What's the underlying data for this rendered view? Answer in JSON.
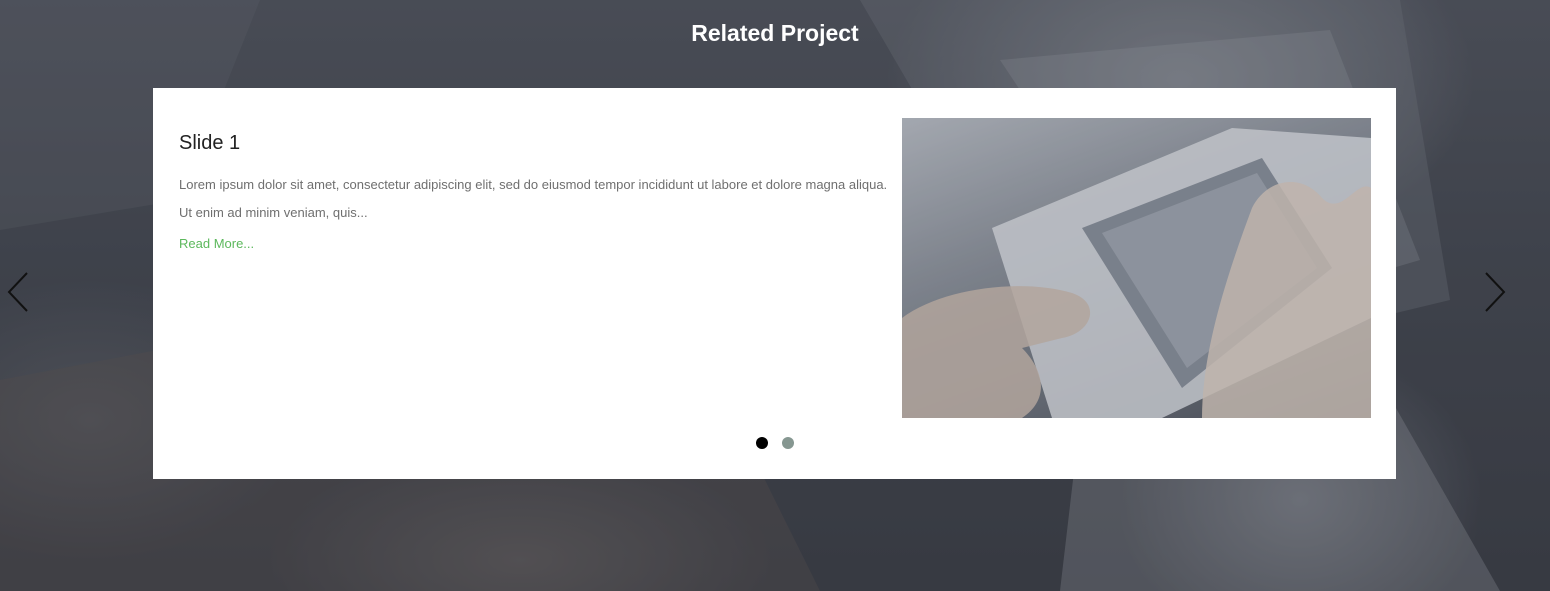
{
  "section": {
    "title": "Related Project"
  },
  "carousel": {
    "active_index": 1,
    "slide_count": 2,
    "slide": {
      "title": "Slide 1",
      "text": "Lorem ipsum dolor sit amet, consectetur adipiscing elit, sed do eiusmod tempor incididunt ut labore et dolore magna aliqua. Ut enim ad minim veniam, quis...",
      "link_label": "Read More..."
    },
    "prev_icon": "chevron-left-icon",
    "next_icon": "chevron-right-icon"
  },
  "colors": {
    "link": "#5cb85c",
    "dot_active": "#000000",
    "dot_inactive": "#869791",
    "title": "#ffffff"
  }
}
